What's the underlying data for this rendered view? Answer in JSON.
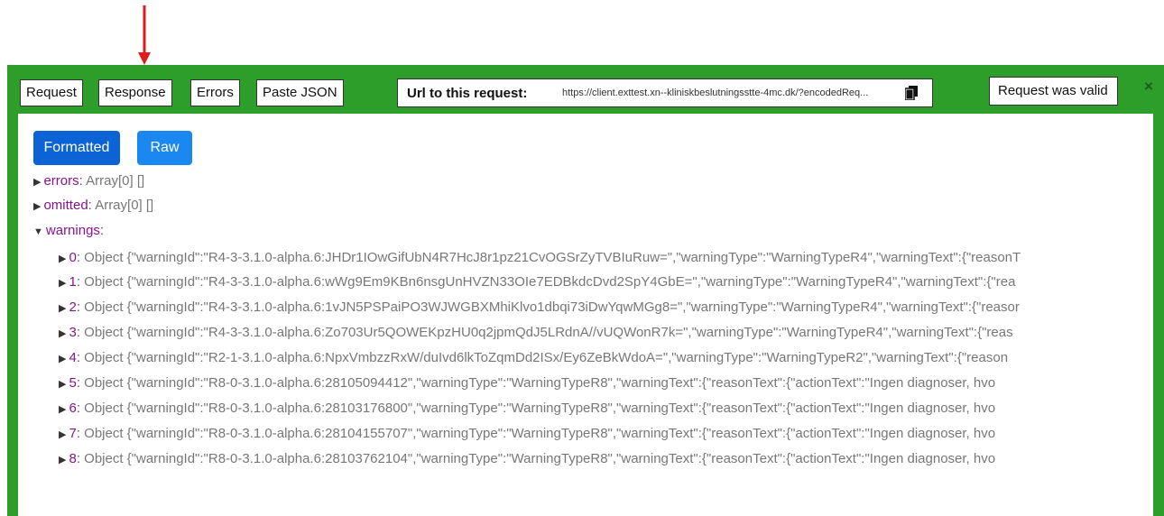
{
  "toolbar": {
    "request_label": "Request",
    "response_label": "Response",
    "errors_label": "Errors",
    "paste_json_label": "Paste JSON",
    "url_label": "Url to this request:",
    "url_value": "https://client.exttest.xn--kliniskbeslutningsstte-4mc.dk/?encodedReq...",
    "status_label": "Request was valid",
    "close": "×"
  },
  "view": {
    "formatted_label": "Formatted",
    "raw_label": "Raw"
  },
  "tree": {
    "errors": {
      "key": "errors",
      "value": "Array[0] []"
    },
    "omitted": {
      "key": "omitted",
      "value": "Array[0] []"
    },
    "warnings": {
      "key": "warnings"
    },
    "items": [
      {
        "index": "0",
        "text": "Object {\"warningId\":\"R4-3-3.1.0-alpha.6:JHDr1IOwGifUbN4R7HcJ8r1pz21CvOGSrZyTVBIuRuw=\",\"warningType\":\"WarningTypeR4\",\"warningText\":{\"reasonT"
      },
      {
        "index": "1",
        "text": "Object {\"warningId\":\"R4-3-3.1.0-alpha.6:wWg9Em9KBn6nsgUnHVZN33OIe7EDBkdcDvd2SpY4GbE=\",\"warningType\":\"WarningTypeR4\",\"warningText\":{\"rea"
      },
      {
        "index": "2",
        "text": "Object {\"warningId\":\"R4-3-3.1.0-alpha.6:1vJN5PSPaiPO3WJWGBXMhiKlvo1dbqi73iDwYqwMGg8=\",\"warningType\":\"WarningTypeR4\",\"warningText\":{\"reasor"
      },
      {
        "index": "3",
        "text": "Object {\"warningId\":\"R4-3-3.1.0-alpha.6:Zo703Ur5QOWEKpzHU0q2jpmQdJ5LRdnA//vUQWonR7k=\",\"warningType\":\"WarningTypeR4\",\"warningText\":{\"reas"
      },
      {
        "index": "4",
        "text": "Object {\"warningId\":\"R2-1-3.1.0-alpha.6:NpxVmbzzRxW/duIvd6lkToZqmDd2ISx/Ey6ZeBkWdoA=\",\"warningType\":\"WarningTypeR2\",\"warningText\":{\"reason"
      },
      {
        "index": "5",
        "text": "Object {\"warningId\":\"R8-0-3.1.0-alpha.6:28105094412\",\"warningType\":\"WarningTypeR8\",\"warningText\":{\"reasonText\":{\"actionText\":\"Ingen diagnoser, hvo"
      },
      {
        "index": "6",
        "text": "Object {\"warningId\":\"R8-0-3.1.0-alpha.6:28103176800\",\"warningType\":\"WarningTypeR8\",\"warningText\":{\"reasonText\":{\"actionText\":\"Ingen diagnoser, hvo"
      },
      {
        "index": "7",
        "text": "Object {\"warningId\":\"R8-0-3.1.0-alpha.6:28104155707\",\"warningType\":\"WarningTypeR8\",\"warningText\":{\"reasonText\":{\"actionText\":\"Ingen diagnoser, hvo"
      },
      {
        "index": "8",
        "text": "Object {\"warningId\":\"R8-0-3.1.0-alpha.6:28103762104\",\"warningType\":\"WarningTypeR8\",\"warningText\":{\"reasonText\":{\"actionText\":\"Ingen diagnoser, hvo"
      }
    ]
  },
  "colors": {
    "panel_green": "#2e9e2a",
    "primary_blue": "#0b63d6",
    "key_purple": "#881391",
    "arrow_red": "#e01b1b"
  }
}
